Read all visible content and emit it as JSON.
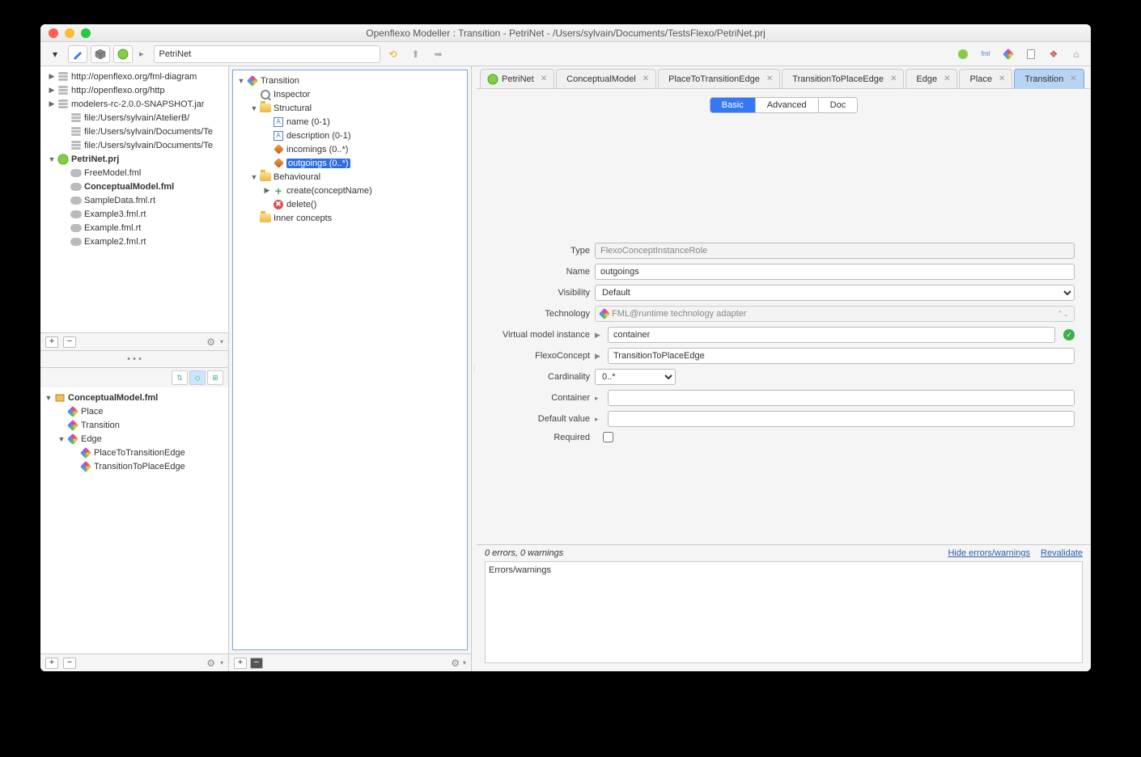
{
  "window_title": "Openflexo Modeller : Transition - PetriNet - /Users/sylvain/Documents/TestsFlexo/PetriNet.prj",
  "toolbar": {
    "search_value": "PetriNet"
  },
  "browser": {
    "items": [
      {
        "label": "http://openflexo.org/fml-diagram",
        "icon": "db",
        "indent": 0,
        "arrow": ">"
      },
      {
        "label": "http://openflexo.org/http",
        "icon": "db",
        "indent": 0,
        "arrow": ">"
      },
      {
        "label": "modelers-rc-2.0.0-SNAPSHOT.jar",
        "icon": "db",
        "indent": 0,
        "arrow": ">"
      },
      {
        "label": "file:/Users/sylvain/AtelierB/",
        "icon": "db",
        "indent": 1,
        "arrow": ""
      },
      {
        "label": "file:/Users/sylvain/Documents/Te",
        "icon": "db",
        "indent": 1,
        "arrow": ""
      },
      {
        "label": "file:/Users/sylvain/Documents/Te",
        "icon": "db",
        "indent": 1,
        "arrow": ""
      },
      {
        "label": "PetriNet.prj",
        "icon": "prj",
        "indent": 0,
        "arrow": "v",
        "bold": true
      },
      {
        "label": "FreeModel.fml",
        "icon": "cloud",
        "indent": 1,
        "arrow": ""
      },
      {
        "label": "ConceptualModel.fml",
        "icon": "cloud",
        "indent": 1,
        "arrow": "",
        "bold": true
      },
      {
        "label": "SampleData.fml.rt",
        "icon": "cloud",
        "indent": 1,
        "arrow": ""
      },
      {
        "label": "Example3.fml.rt",
        "icon": "cloud",
        "indent": 1,
        "arrow": ""
      },
      {
        "label": "Example.fml.rt",
        "icon": "cloud",
        "indent": 1,
        "arrow": ""
      },
      {
        "label": "Example2.fml.rt",
        "icon": "cloud",
        "indent": 1,
        "arrow": ""
      }
    ]
  },
  "outline": {
    "items": [
      {
        "label": "ConceptualModel.fml",
        "icon": "box",
        "indent": 0,
        "arrow": "v",
        "bold": true
      },
      {
        "label": "Place",
        "icon": "multi",
        "indent": 1,
        "arrow": ""
      },
      {
        "label": "Transition",
        "icon": "multi",
        "indent": 1,
        "arrow": ""
      },
      {
        "label": "Edge",
        "icon": "multi",
        "indent": 1,
        "arrow": "v"
      },
      {
        "label": "PlaceToTransitionEdge",
        "icon": "multi",
        "indent": 2,
        "arrow": ""
      },
      {
        "label": "TransitionToPlaceEdge",
        "icon": "multi",
        "indent": 2,
        "arrow": ""
      }
    ]
  },
  "center_tree": {
    "items": [
      {
        "label": "Transition",
        "icon": "multi",
        "indent": 0,
        "arrow": "v"
      },
      {
        "label": "Inspector",
        "icon": "mag",
        "indent": 1,
        "arrow": ""
      },
      {
        "label": "Structural",
        "icon": "fold",
        "indent": 1,
        "arrow": "v"
      },
      {
        "label": "name (0-1)",
        "icon": "txt",
        "indent": 2,
        "arrow": ""
      },
      {
        "label": "description (0-1)",
        "icon": "txt",
        "indent": 2,
        "arrow": ""
      },
      {
        "label": "incomings (0..*)",
        "icon": "cube",
        "indent": 2,
        "arrow": ""
      },
      {
        "label": "outgoings (0..*)",
        "icon": "cube",
        "indent": 2,
        "arrow": "",
        "selected": true
      },
      {
        "label": "Behavioural",
        "icon": "fold",
        "indent": 1,
        "arrow": "v"
      },
      {
        "label": "create(conceptName)",
        "icon": "plus",
        "indent": 2,
        "arrow": ">"
      },
      {
        "label": "delete()",
        "icon": "del",
        "indent": 2,
        "arrow": ""
      },
      {
        "label": "Inner concepts",
        "icon": "fold",
        "indent": 1,
        "arrow": ""
      }
    ]
  },
  "tabs": [
    {
      "label": "PetriNet",
      "icon": "prj"
    },
    {
      "label": "ConceptualModel",
      "icon": "multi"
    },
    {
      "label": "PlaceToTransitionEdge",
      "icon": "multi"
    },
    {
      "label": "TransitionToPlaceEdge",
      "icon": "multi"
    },
    {
      "label": "Edge",
      "icon": "multi"
    },
    {
      "label": "Place",
      "icon": "multi"
    },
    {
      "label": "Transition",
      "icon": "multi",
      "active": true
    }
  ],
  "view_switch": {
    "basic": "Basic",
    "advanced": "Advanced",
    "doc": "Doc"
  },
  "form": {
    "type_label": "Type",
    "type_value": "FlexoConceptInstanceRole",
    "name_label": "Name",
    "name_value": "outgoings",
    "visibility_label": "Visibility",
    "visibility_value": "Default",
    "technology_label": "Technology",
    "technology_value": "FML@runtime technology adapter",
    "vmi_label": "Virtual model instance",
    "vmi_value": "container",
    "concept_label": "FlexoConcept",
    "concept_value": "TransitionToPlaceEdge",
    "cardinality_label": "Cardinality",
    "cardinality_value": "0..*",
    "container_label": "Container",
    "container_value": "",
    "default_label": "Default value",
    "default_value": "",
    "required_label": "Required"
  },
  "errors": {
    "summary": "0 errors, 0 warnings",
    "hide": "Hide errors/warnings",
    "revalidate": "Revalidate",
    "header": "Errors/warnings"
  }
}
